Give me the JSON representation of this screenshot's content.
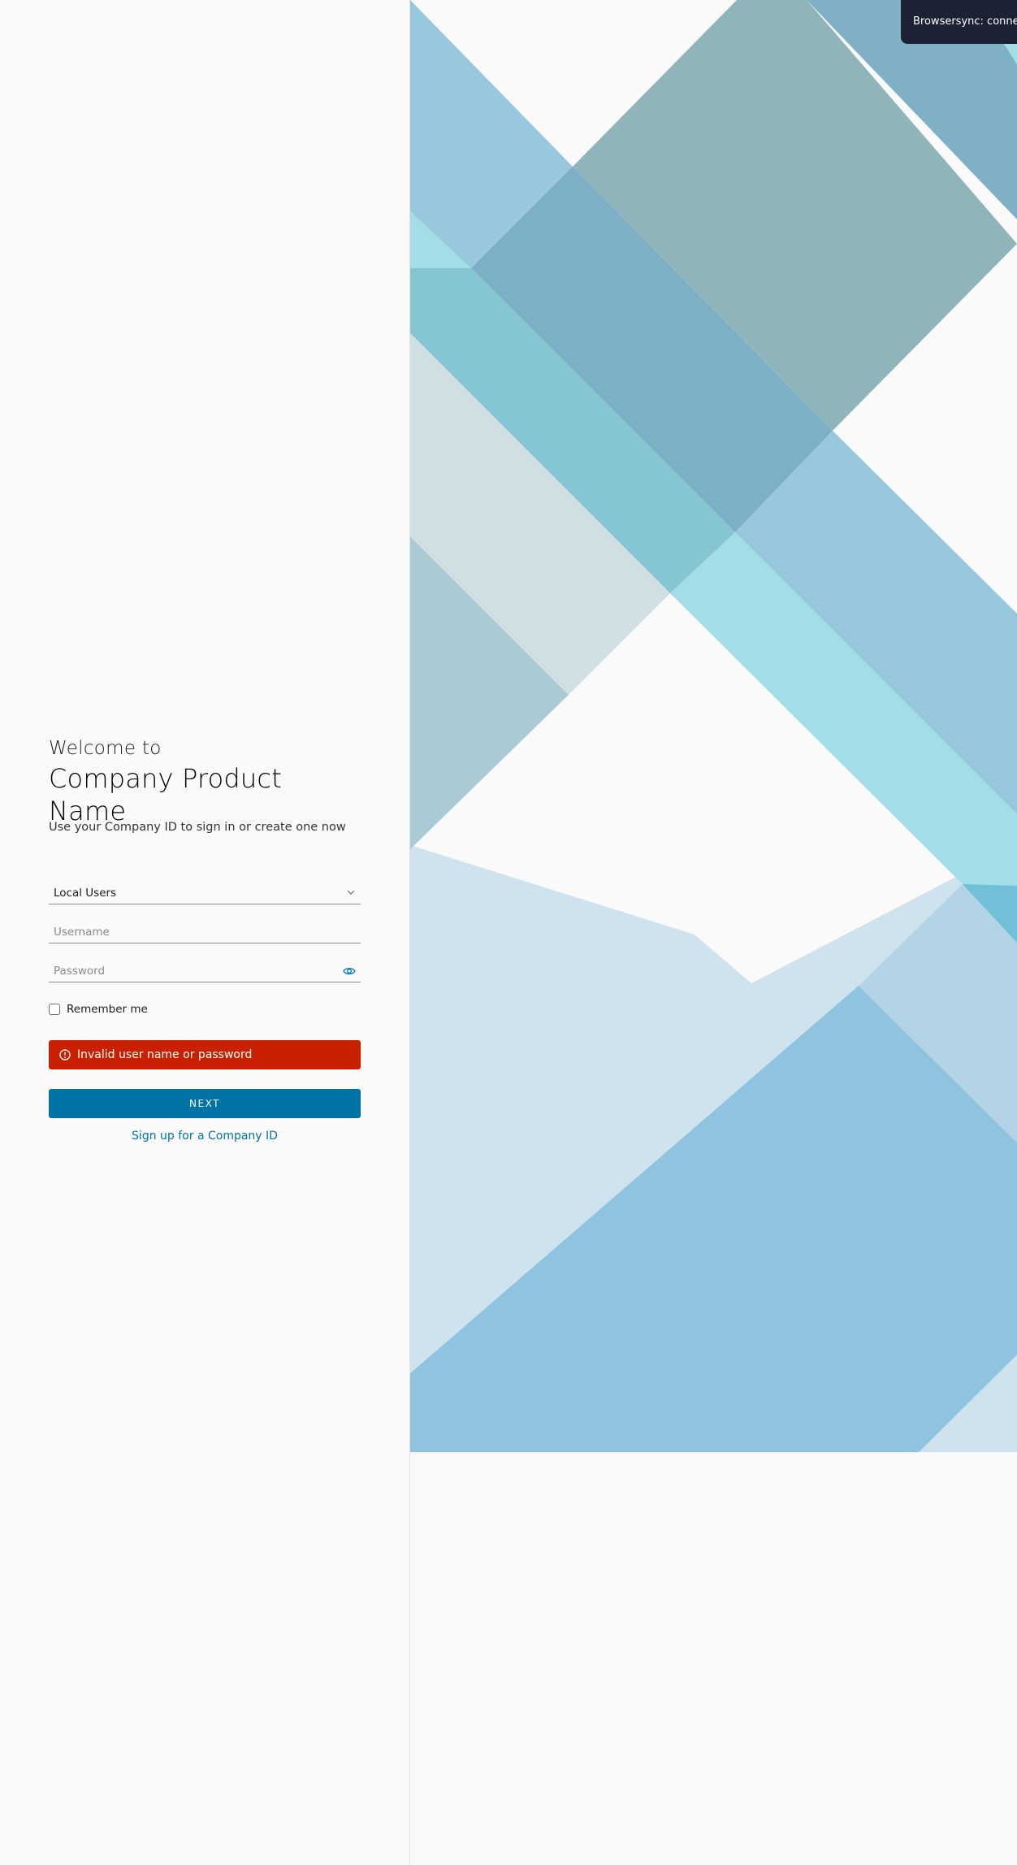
{
  "welcome": "Welcome to",
  "product_name": "Company Product Name",
  "subtitle": "Use your Company ID to sign in or create one now",
  "domain_select": {
    "value": "Local Users",
    "icon": "chevron-down-icon"
  },
  "username": {
    "placeholder": "Username",
    "value": ""
  },
  "password": {
    "placeholder": "Password",
    "value": "",
    "icon": "eye-icon"
  },
  "remember": {
    "label": "Remember me",
    "checked": false
  },
  "error": {
    "text": "Invalid user name or password",
    "icon": "error-circle-icon",
    "color": "#c92100"
  },
  "next_button": {
    "label": "NEXT",
    "color": "#0072a3"
  },
  "signup_link": "Sign up for a Company ID",
  "toast": "Browsersync: connected"
}
